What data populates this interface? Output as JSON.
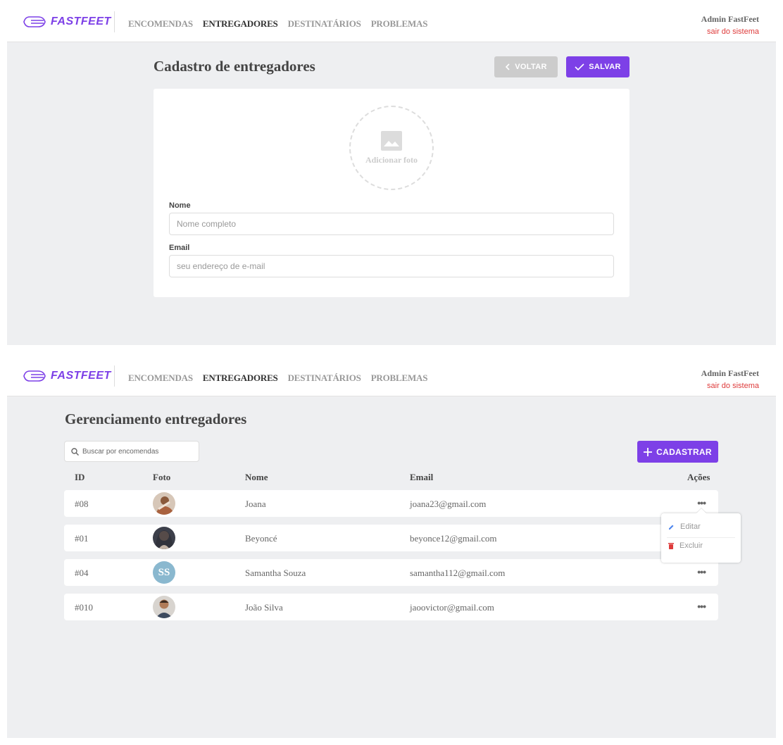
{
  "app": {
    "logo_text": "FASTFEET",
    "accent": "#7d40e7",
    "danger": "#de3b3b"
  },
  "nav": {
    "items": [
      "ENCOMENDAS",
      "ENTREGADORES",
      "DESTINATÁRIOS",
      "PROBLEMAS"
    ],
    "active": "ENTREGADORES"
  },
  "user": {
    "name": "Admin FastFeet",
    "logout": "sair do sistema"
  },
  "form_screen": {
    "title": "Cadastro de entregadores",
    "back_label": "VOLTAR",
    "save_label": "SALVAR",
    "photo_label": "Adicionar foto",
    "name_label": "Nome",
    "name_placeholder": "Nome completo",
    "email_label": "Email",
    "email_placeholder": "seu endereço de e-mail"
  },
  "list_screen": {
    "title": "Gerenciamento entregadores",
    "search_placeholder": "Buscar por encomendas",
    "add_label": "CADASTRAR",
    "columns": {
      "id": "ID",
      "photo": "Foto",
      "name": "Nome",
      "email": "Email",
      "actions": "Ações"
    },
    "rows": [
      {
        "id": "#08",
        "name": "Joana",
        "email": "joana23@gmail.com",
        "avatar": "photo"
      },
      {
        "id": "#01",
        "name": "Beyoncé",
        "email": "beyonce12@gmail.com",
        "avatar": "photo"
      },
      {
        "id": "#04",
        "name": "Samantha Souza",
        "email": "samantha112@gmail.com",
        "avatar": "initials",
        "initials": "SS"
      },
      {
        "id": "#010",
        "name": "João Silva",
        "email": "jaoovictor@gmail.com",
        "avatar": "photo"
      }
    ],
    "actions_menu": {
      "edit": "Editar",
      "delete": "Excluir"
    }
  }
}
